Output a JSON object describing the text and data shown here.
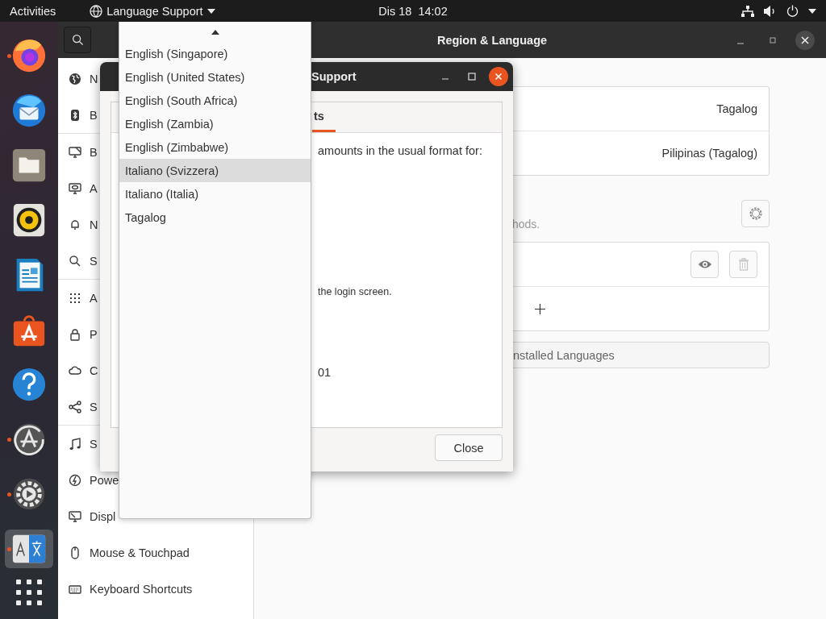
{
  "top_bar": {
    "activities": "Activities",
    "app_menu": "Language Support",
    "clock": "Dis 18  14:02"
  },
  "dock": {
    "items": [
      {
        "running": true,
        "selected": false
      },
      {
        "running": false,
        "selected": false
      },
      {
        "running": false,
        "selected": false
      },
      {
        "running": false,
        "selected": false
      },
      {
        "running": false,
        "selected": false
      },
      {
        "running": false,
        "selected": false
      },
      {
        "running": false,
        "selected": false
      },
      {
        "running": true,
        "selected": false
      },
      {
        "running": true,
        "selected": false
      },
      {
        "running": true,
        "selected": true
      }
    ]
  },
  "settings_window": {
    "title": "Region & Language",
    "sidebar": {
      "groups": [
        {
          "items": [
            "N",
            "B"
          ]
        },
        {
          "items": [
            "B",
            "A",
            "N",
            "S"
          ]
        },
        {
          "items": [
            "A",
            "P",
            "C",
            "S"
          ]
        },
        {
          "items": [
            "S",
            "Powe",
            "Displ",
            "Mouse & Touchpad",
            "Keyboard Shortcuts"
          ]
        }
      ]
    },
    "rows": [
      {
        "value": "Tagalog"
      },
      {
        "value": "Pilipinas (Tagalog)"
      }
    ],
    "input_sources_hint": "hods.",
    "manage_button": "nstalled Languages"
  },
  "dialog": {
    "title": "Support",
    "tab": {
      "label": "ts",
      "selected": true
    },
    "texts": [
      "amounts in the usual format for:",
      "the login screen.",
      "01"
    ],
    "close_button": "Close"
  },
  "dropdown_menu": {
    "items": [
      {
        "label": "English (Singapore)",
        "selected": false
      },
      {
        "label": "English (United States)",
        "selected": false
      },
      {
        "label": "English (South Africa)",
        "selected": false
      },
      {
        "label": "English (Zambia)",
        "selected": false
      },
      {
        "label": "English (Zimbabwe)",
        "selected": false
      },
      {
        "label": "Italiano (Svizzera)",
        "selected": true
      },
      {
        "label": "Italiano (Italia)",
        "selected": false
      },
      {
        "label": "Tagalog",
        "selected": false
      }
    ]
  }
}
